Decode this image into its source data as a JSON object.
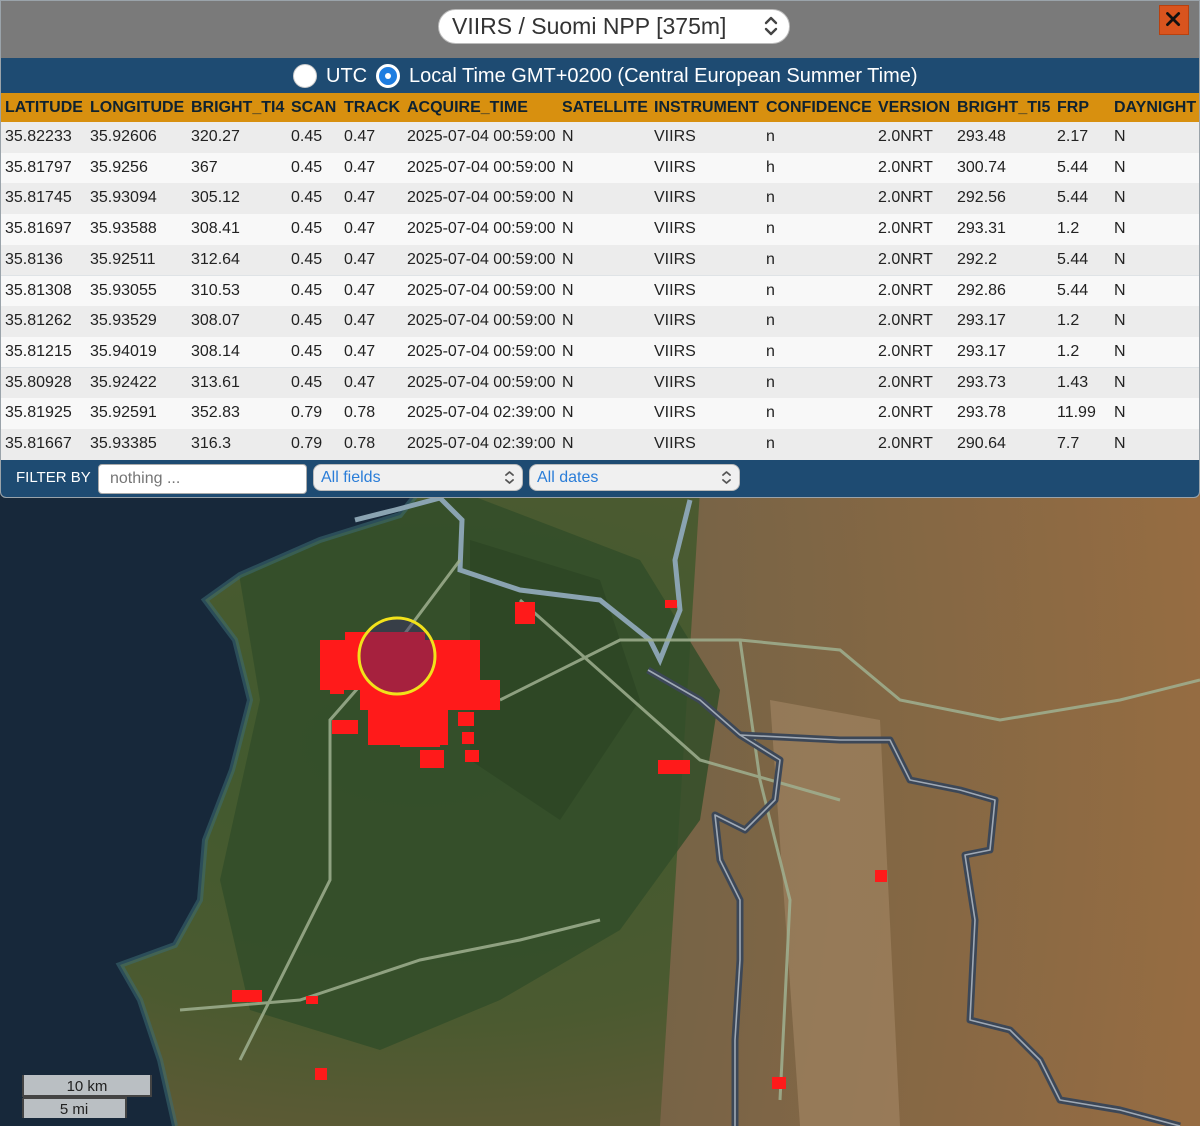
{
  "sensor_select": {
    "value": "VIIRS / Suomi NPP [375m]"
  },
  "close_label": "✕",
  "time_options": {
    "utc_label": "UTC",
    "local_label": "Local Time GMT+0200 (Central European Summer Time)",
    "selected": "local"
  },
  "table": {
    "columns": [
      "LATITUDE",
      "LONGITUDE",
      "BRIGHT_TI4",
      "SCAN",
      "TRACK",
      "ACQUIRE_TIME",
      "SATELLITE",
      "INSTRUMENT",
      "CONFIDENCE",
      "VERSION",
      "BRIGHT_TI5",
      "FRP",
      "DAYNIGHT"
    ],
    "rows": [
      [
        "35.82233",
        "35.92606",
        "320.27",
        "0.45",
        "0.47",
        "2025-07-04 00:59:00",
        "N",
        "VIIRS",
        "n",
        "2.0NRT",
        "293.48",
        "2.17",
        "N"
      ],
      [
        "35.81797",
        "35.9256",
        "367",
        "0.45",
        "0.47",
        "2025-07-04 00:59:00",
        "N",
        "VIIRS",
        "h",
        "2.0NRT",
        "300.74",
        "5.44",
        "N"
      ],
      [
        "35.81745",
        "35.93094",
        "305.12",
        "0.45",
        "0.47",
        "2025-07-04 00:59:00",
        "N",
        "VIIRS",
        "n",
        "2.0NRT",
        "292.56",
        "5.44",
        "N"
      ],
      [
        "35.81697",
        "35.93588",
        "308.41",
        "0.45",
        "0.47",
        "2025-07-04 00:59:00",
        "N",
        "VIIRS",
        "n",
        "2.0NRT",
        "293.31",
        "1.2",
        "N"
      ],
      [
        "35.8136",
        "35.92511",
        "312.64",
        "0.45",
        "0.47",
        "2025-07-04 00:59:00",
        "N",
        "VIIRS",
        "n",
        "2.0NRT",
        "292.2",
        "5.44",
        "N"
      ],
      [
        "35.81308",
        "35.93055",
        "310.53",
        "0.45",
        "0.47",
        "2025-07-04 00:59:00",
        "N",
        "VIIRS",
        "n",
        "2.0NRT",
        "292.86",
        "5.44",
        "N"
      ],
      [
        "35.81262",
        "35.93529",
        "308.07",
        "0.45",
        "0.47",
        "2025-07-04 00:59:00",
        "N",
        "VIIRS",
        "n",
        "2.0NRT",
        "293.17",
        "1.2",
        "N"
      ],
      [
        "35.81215",
        "35.94019",
        "308.14",
        "0.45",
        "0.47",
        "2025-07-04 00:59:00",
        "N",
        "VIIRS",
        "n",
        "2.0NRT",
        "293.17",
        "1.2",
        "N"
      ],
      [
        "35.80928",
        "35.92422",
        "313.61",
        "0.45",
        "0.47",
        "2025-07-04 00:59:00",
        "N",
        "VIIRS",
        "n",
        "2.0NRT",
        "293.73",
        "1.43",
        "N"
      ],
      [
        "35.81925",
        "35.92591",
        "352.83",
        "0.79",
        "0.78",
        "2025-07-04 02:39:00",
        "N",
        "VIIRS",
        "n",
        "2.0NRT",
        "293.78",
        "11.99",
        "N"
      ],
      [
        "35.81667",
        "35.93385",
        "316.3",
        "0.79",
        "0.78",
        "2025-07-04 02:39:00",
        "N",
        "VIIRS",
        "n",
        "2.0NRT",
        "290.64",
        "7.7",
        "N"
      ]
    ]
  },
  "filter": {
    "label": "FILTER BY",
    "placeholder": "nothing ...",
    "field_select": "All fields",
    "date_select": "All dates"
  },
  "scale": {
    "km_label": "10 km",
    "mi_label": "5 mi"
  },
  "colors": {
    "header_bg": "#d8900f",
    "bar_bg": "#1e4b72",
    "fire": "#ff1a1a",
    "highlight": "#f2e21a",
    "close_btn": "#d9541e"
  }
}
